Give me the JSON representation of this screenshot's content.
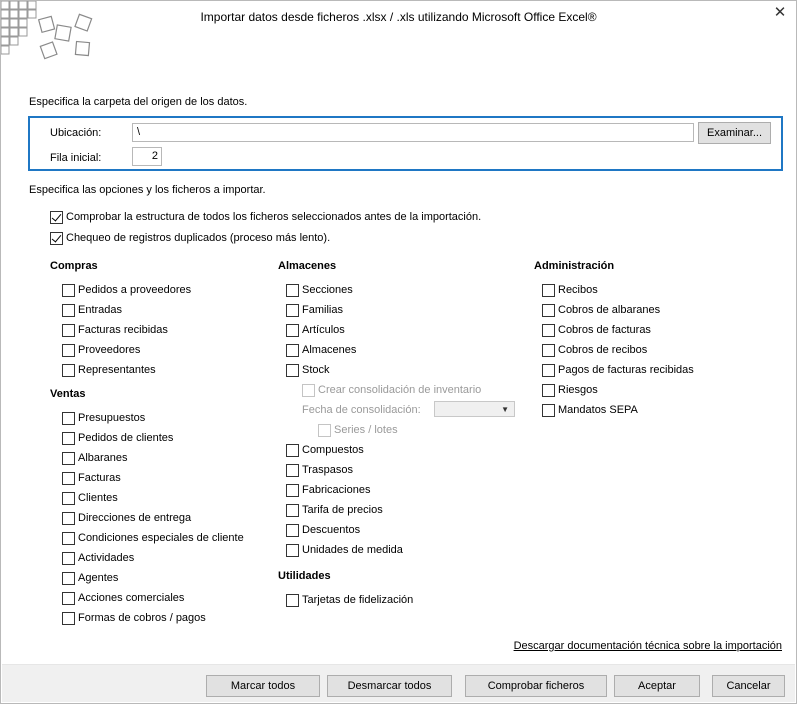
{
  "window": {
    "title": "Importar datos desde ficheros .xlsx / .xls utilizando Microsoft Office Excel®",
    "close_glyph": "✕"
  },
  "origin": {
    "heading": "Especifica la carpeta del origen de los datos.",
    "location_label": "Ubicación:",
    "location_value": "\\",
    "initial_row_label": "Fila inicial:",
    "initial_row_value": "2",
    "browse_label": "Examinar..."
  },
  "options": {
    "heading": "Especifica las opciones y los ficheros a importar.",
    "check_structure": {
      "label": "Comprobar la estructura de todos los ficheros seleccionados antes de la importación.",
      "checked": true
    },
    "check_duplicates": {
      "label": "Chequeo de registros duplicados (proceso más lento).",
      "checked": true
    }
  },
  "groups": {
    "compras": {
      "title": "Compras",
      "items": [
        "Pedidos a proveedores",
        "Entradas",
        "Facturas recibidas",
        "Proveedores",
        "Representantes"
      ]
    },
    "ventas": {
      "title": "Ventas",
      "items": [
        "Presupuestos",
        "Pedidos de clientes",
        "Albaranes",
        "Facturas",
        "Clientes",
        "Direcciones de entrega",
        "Condiciones especiales de cliente",
        "Actividades",
        "Agentes",
        "Acciones comerciales",
        "Formas de cobros / pagos"
      ]
    },
    "almacenes": {
      "title": "Almacenes",
      "items_top": [
        "Secciones",
        "Familias",
        "Artículos",
        "Almacenes",
        "Stock"
      ],
      "crear_consolidacion": "Crear consolidación de inventario",
      "fecha_consolidacion": "Fecha de consolidación:",
      "series_lotes": "Series / lotes",
      "items_bottom": [
        "Compuestos",
        "Traspasos",
        "Fabricaciones",
        "Tarifa de precios",
        "Descuentos",
        "Unidades de medida"
      ]
    },
    "utilidades": {
      "title": "Utilidades",
      "items": [
        "Tarjetas de fidelización"
      ]
    },
    "administracion": {
      "title": "Administración",
      "items": [
        "Recibos",
        "Cobros de albaranes",
        "Cobros de facturas",
        "Cobros de recibos",
        "Pagos de facturas recibidas",
        "Riesgos",
        "Mandatos SEPA"
      ]
    }
  },
  "download_link": "Descargar documentación técnica sobre la importación",
  "buttons": {
    "mark_all": "Marcar todos",
    "unmark_all": "Desmarcar todos",
    "check_files": "Comprobar ficheros",
    "accept": "Aceptar",
    "cancel": "Cancelar"
  },
  "colors": {
    "accent_border": "#1f77c4",
    "button_bg": "#e1e1e1",
    "footer_bg": "#f0f0f0"
  }
}
